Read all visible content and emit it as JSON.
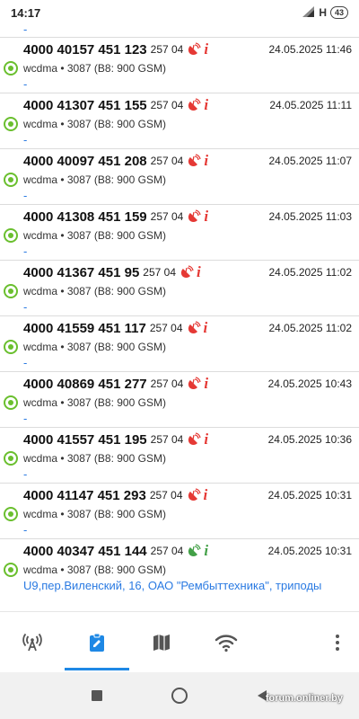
{
  "status_bar": {
    "time": "14:17",
    "network": "H",
    "battery": "43"
  },
  "list": {
    "top_dash": "-",
    "rows": [
      {
        "cell": "4000 40157 451 123",
        "mccmnc": "257 04",
        "time": "24.05.2025 11:46",
        "tech": "wcdma • 3087 (B8: 900 GSM)",
        "address": "-"
      },
      {
        "cell": "4000 41307 451 155",
        "mccmnc": "257 04",
        "time": "24.05.2025 11:11",
        "tech": "wcdma • 3087 (B8: 900 GSM)",
        "address": "-"
      },
      {
        "cell": "4000 40097 451 208",
        "mccmnc": "257 04",
        "time": "24.05.2025 11:07",
        "tech": "wcdma • 3087 (B8: 900 GSM)",
        "address": "-"
      },
      {
        "cell": "4000 41308 451 159",
        "mccmnc": "257 04",
        "time": "24.05.2025 11:03",
        "tech": "wcdma • 3087 (B8: 900 GSM)",
        "address": "-"
      },
      {
        "cell": "4000 41367 451 95",
        "mccmnc": "257 04",
        "time": "24.05.2025 11:02",
        "tech": "wcdma • 3087 (B8: 900 GSM)",
        "address": "-"
      },
      {
        "cell": "4000 41559 451 117",
        "mccmnc": "257 04",
        "time": "24.05.2025 11:02",
        "tech": "wcdma • 3087 (B8: 900 GSM)",
        "address": "-"
      },
      {
        "cell": "4000 40869 451 277",
        "mccmnc": "257 04",
        "time": "24.05.2025 10:43",
        "tech": "wcdma • 3087 (B8: 900 GSM)",
        "address": "-"
      },
      {
        "cell": "4000 41557 451 195",
        "mccmnc": "257 04",
        "time": "24.05.2025 10:36",
        "tech": "wcdma • 3087 (B8: 900 GSM)",
        "address": "-"
      },
      {
        "cell": "4000 41147 451 293",
        "mccmnc": "257 04",
        "time": "24.05.2025 10:31",
        "tech": "wcdma • 3087 (B8: 900 GSM)",
        "address": "-"
      },
      {
        "cell": "4000 40347 451 144",
        "mccmnc": "257 04",
        "time": "24.05.2025 10:31",
        "tech": "wcdma • 3087 (B8: 900 GSM)",
        "address": "U9,пер.Виленский, 16, ОАО \"Рембыттехника\", триподы"
      }
    ],
    "icon_colors": {
      "red": "#e53935",
      "green": "#43a047"
    }
  },
  "bottom_nav": {
    "items": [
      "antenna-tab",
      "log-tab",
      "map-tab",
      "wifi-tab"
    ],
    "active": "log-tab",
    "accent": "#1e88e5"
  },
  "watermark": "forum.onliner.by"
}
